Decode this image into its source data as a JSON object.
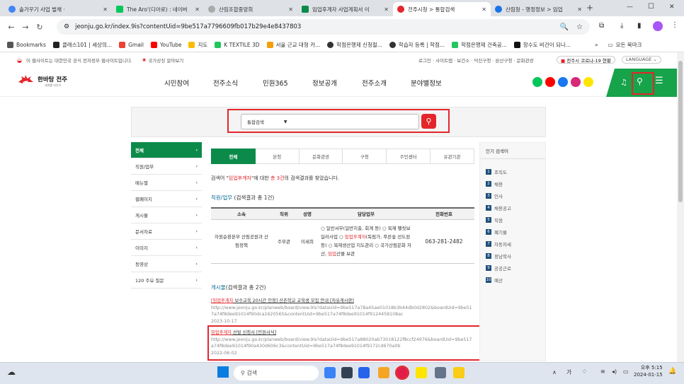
{
  "tabs": [
    {
      "label": "솔가꾸기 사업 벌채 ·",
      "color": "#4285f4"
    },
    {
      "label": "The Aro'(디아로) : 네이버",
      "color": "#03c75a"
    },
    {
      "label": "산림조합중앙회",
      "color": "#888888"
    },
    {
      "label": "임업후계자 사업계획서 이",
      "color": "#0c8a4a"
    },
    {
      "label": "전주시청 > 통합검색",
      "color": "#e3262b"
    },
    {
      "label": "산림청 - 행정정보 > 임업",
      "color": "#1a73e8"
    }
  ],
  "window": {
    "minimize": "—",
    "maximize": "☐",
    "close": "✕",
    "new_tab": "+"
  },
  "url": "jeonju.go.kr/index.9is?contentUid=9be517a7796609fb017b29e4e8437803",
  "bookmarks": [
    "Bookmarks",
    "클래스101 | 세상의...",
    "Gmail",
    "YouTube",
    "지도",
    "K TEXTILE 3D",
    "서울 근교 대형 카...",
    "학점은행제 신청절...",
    "학습자 등록 | 학점...",
    "학점은행제 건축공...",
    "항수도 비건이 되나..."
  ],
  "bookmarks_more": "»",
  "bookmarks_all": "모든 북마크",
  "gov_notice": "이 웹사이트는 대한민국 공식 전자정부 웹사이트입니다.",
  "gov_check": "국가상징 알아보기",
  "util_links": "로그인 · 사이트맵 · 보건소 · 덕진구청 · 완산구청 · 문화관광",
  "covid": "전주시 코로나-19 현황",
  "language": "LANGUAGE",
  "logo_text": "한바탕 전주",
  "logo_sub": "세계를 비추다",
  "gnb": [
    "시민참여",
    "전주소식",
    "민원365",
    "정보공개",
    "전주소개",
    "분야별정보"
  ],
  "search": {
    "scope": "통합검색",
    "placeholder": ""
  },
  "left_nav": [
    "전체",
    "직원/업무",
    "메뉴별",
    "웹페이지",
    "게시물",
    "문서자료",
    "이미지",
    "동영상",
    "120 주요 질문"
  ],
  "result_tabs": [
    "전체",
    "본청",
    "문화관광",
    "구청",
    "주민센터",
    "유관기관"
  ],
  "summary": {
    "prefix": "검색어 \"",
    "keyword": "임업후계자",
    "middle": "\"에 대한 ",
    "total": "총 3건",
    "suffix": "의 검색결과를 찾았습니다."
  },
  "staff_title": "직원/업무",
  "staff_count": "(검색결과 총 1건)",
  "table": {
    "headers": [
      "소속",
      "직위",
      "성명",
      "담당업무",
      "전화번호"
    ],
    "row": {
      "dept": "자원순환본부 산림공원과 산림정책",
      "position": "주무관",
      "name": "이세희",
      "duty_a": "○ 일반서무(일반지출, 회계 등) ○ 목재 펠릿보일러사업 ○ ",
      "duty_kw1": "임업후계자",
      "duty_b": "(독림가, 푸른숲 선도원 등) ○ 목재생산업 지도관리 ○ 국가산림문화 자산, ",
      "duty_kw2": "임업",
      "duty_c": "산물 보관",
      "phone": "063-281-2482"
    }
  },
  "board_title": "게시물",
  "board_count": "(검색결과 총 2건)",
  "posts": [
    {
      "kw": "[임업후계자",
      "title": " 보수교육 20시간 인정] 산촌학교 교육생 모집 안내 [자유게시판]",
      "url": "http://www.jeonju.go.kr/planweb/board/view.9is?dataUid=9be517a78a45ae01018b3b44db0d2802&boardUid=9be517a74f8dee91014f90dca1620565&contentUid=9be517a74f8dee91014f9124458108ac",
      "date": "2023-10-17"
    },
    {
      "kw": "임업후계자",
      "title": " 선발 신청서 [민원서식]",
      "url": "http://www.jeonju.go.kr/planweb/board/view.9is?dataUid=9be517a88020ab73018122f8ccf24976&boardUid=9be517a74f8dee91014f90a430d606c3&contentUid=9be517a74f8dee91014f9172cd670a0b",
      "date": "2022-06-02"
    }
  ],
  "popular": {
    "title": "인기 검색어",
    "items": [
      "조직도",
      "채용",
      "인사",
      "채용공고",
      "직원",
      "폐기물",
      "자동차세",
      "정남학사",
      "공공근로",
      "예산"
    ]
  },
  "taskbar": {
    "search": "검색",
    "time": "오후 5:15",
    "date": "2024-01-15",
    "lang": "가"
  }
}
